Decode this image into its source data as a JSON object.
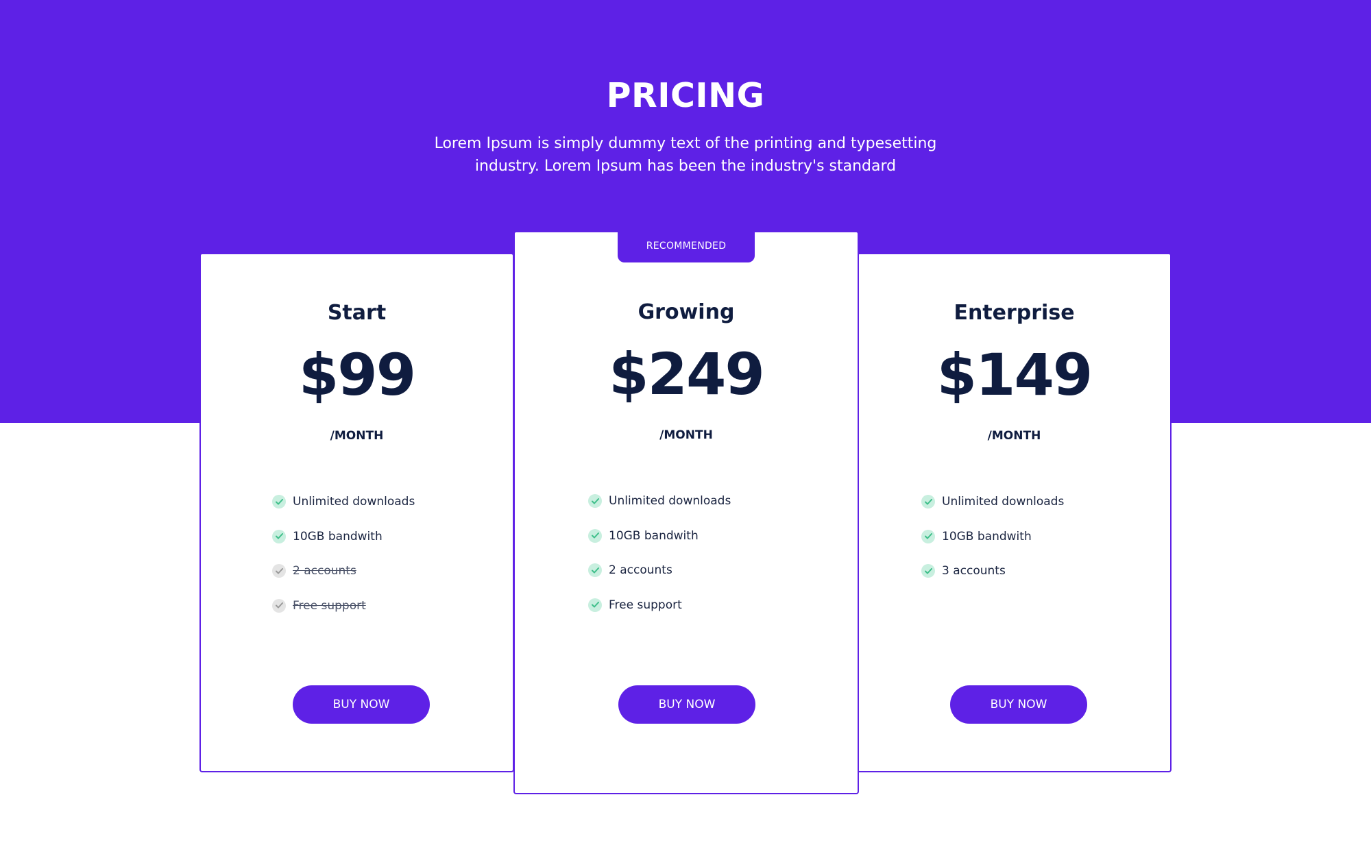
{
  "hero": {
    "title": "PRICING",
    "description": "Lorem Ipsum is simply dummy text of the printing and typesetting industry. Lorem Ipsum has been the industry's standard"
  },
  "colors": {
    "accent": "#5e21e6",
    "text_dark": "#0f1c3f",
    "check_on": "#3fbf8a",
    "check_on_bg": "#c8efdf",
    "check_off": "#9a9a9a",
    "check_off_bg": "#e4e4e4"
  },
  "plans": [
    {
      "name": "Start",
      "price": "$99",
      "period": "/MONTH",
      "button_label": "BUY NOW",
      "features": [
        {
          "text": "Unlimited downloads",
          "icon": "check-icon",
          "included": true
        },
        {
          "text": "10GB bandwith",
          "icon": "check-icon",
          "included": true
        },
        {
          "text": "2 accounts",
          "icon": "check-icon",
          "included": false
        },
        {
          "text": "Free support",
          "icon": "check-icon",
          "included": false
        }
      ]
    },
    {
      "name": "Growing",
      "price": "$249",
      "period": "/MONTH",
      "badge": "RECOMMENDED",
      "button_label": "BUY NOW",
      "features": [
        {
          "text": "Unlimited downloads",
          "icon": "check-icon",
          "included": true
        },
        {
          "text": "10GB bandwith",
          "icon": "check-icon",
          "included": true
        },
        {
          "text": "2 accounts",
          "icon": "check-icon",
          "included": true
        },
        {
          "text": "Free support",
          "icon": "check-icon",
          "included": true
        }
      ]
    },
    {
      "name": "Enterprise",
      "price": "$149",
      "period": "/MONTH",
      "button_label": "BUY NOW",
      "features": [
        {
          "text": "Unlimited downloads",
          "icon": "check-icon",
          "included": true
        },
        {
          "text": "10GB bandwith",
          "icon": "check-icon",
          "included": true
        },
        {
          "text": "3 accounts",
          "icon": "check-icon",
          "included": true
        }
      ]
    }
  ]
}
